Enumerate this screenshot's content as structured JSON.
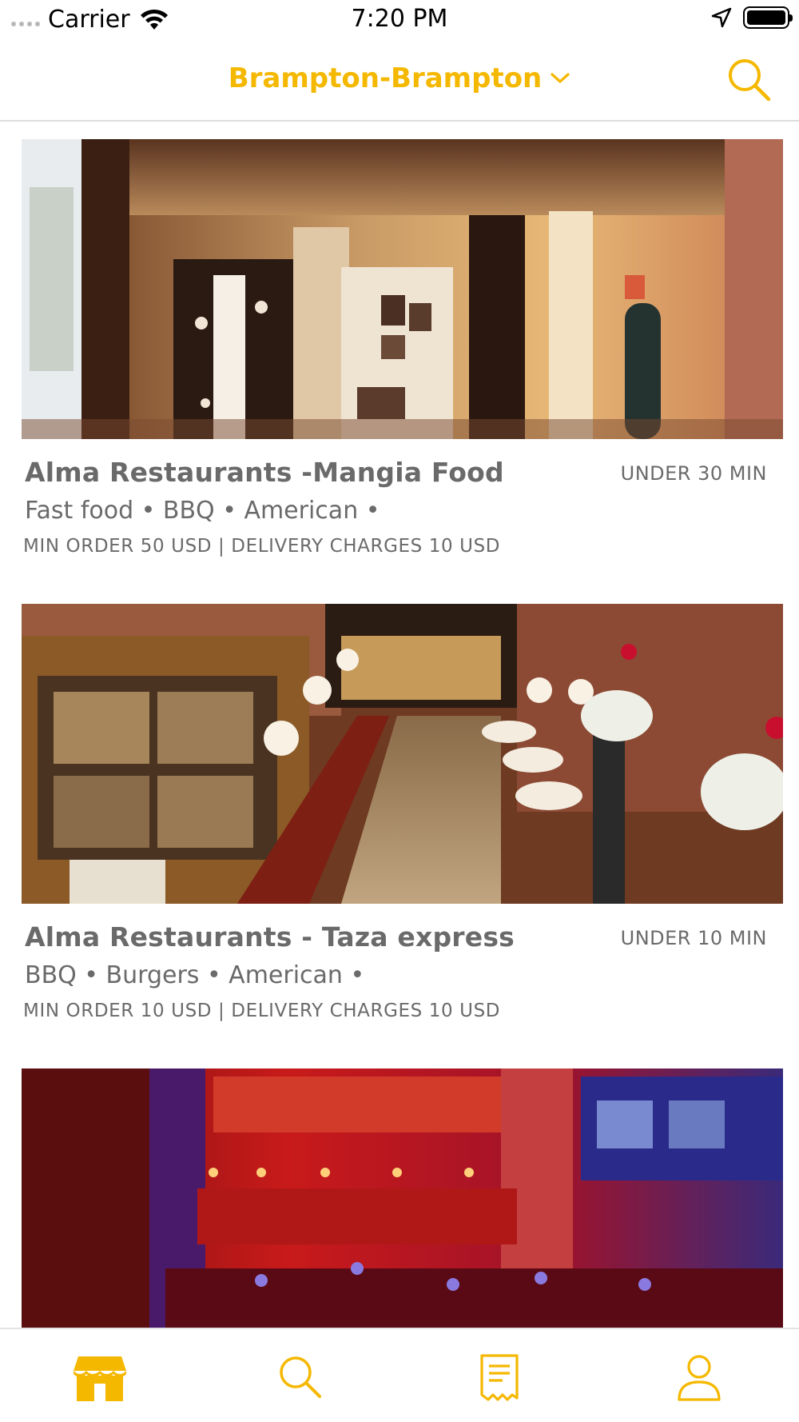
{
  "status_bar": {
    "carrier": "Carrier",
    "time": "7:20 PM"
  },
  "header": {
    "location": "Brampton-Brampton",
    "accent_color": "#f5b800"
  },
  "restaurants": [
    {
      "name": "Alma Restaurants -Mangia Food",
      "delivery_time": "UNDER 30 MIN",
      "cuisines": "Fast food • BBQ • American •",
      "order_info": "MIN ORDER 50 USD | DELIVERY CHARGES 10 USD"
    },
    {
      "name": "Alma Restaurants - Taza express",
      "delivery_time": "UNDER 10 MIN",
      "cuisines": "BBQ • Burgers • American •",
      "order_info": "MIN ORDER 10 USD | DELIVERY CHARGES 10 USD"
    },
    {}
  ],
  "tabbar": {
    "tabs": [
      {
        "icon": "store-icon",
        "active": true
      },
      {
        "icon": "search-icon",
        "active": false
      },
      {
        "icon": "receipt-icon",
        "active": false
      },
      {
        "icon": "user-icon",
        "active": false
      }
    ]
  }
}
